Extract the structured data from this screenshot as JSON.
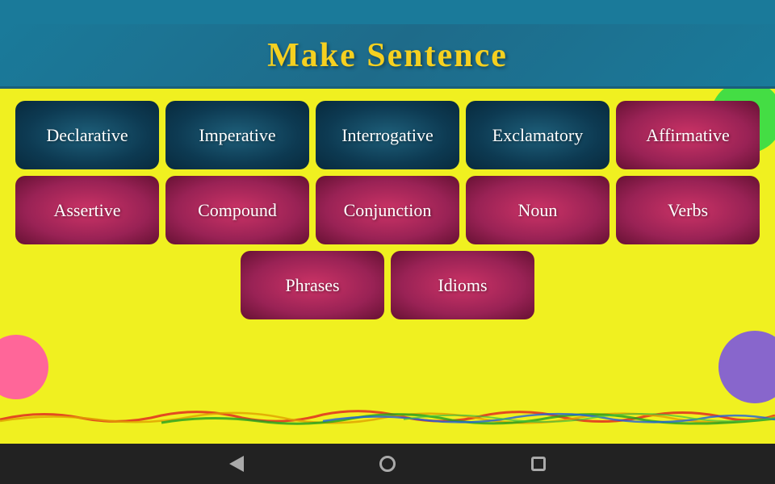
{
  "header": {
    "title": "Make Sentence"
  },
  "rows": [
    {
      "id": "row1",
      "cards": [
        {
          "id": "declarative",
          "label": "Declarative",
          "style": "teal"
        },
        {
          "id": "imperative",
          "label": "Imperative",
          "style": "teal"
        },
        {
          "id": "interrogative",
          "label": "Interrogative",
          "style": "teal"
        },
        {
          "id": "exclamatory",
          "label": "Exclamatory",
          "style": "teal"
        },
        {
          "id": "affirmative",
          "label": "Affirmative",
          "style": "pink"
        }
      ]
    },
    {
      "id": "row2",
      "cards": [
        {
          "id": "assertive",
          "label": "Assertive",
          "style": "pink"
        },
        {
          "id": "compound",
          "label": "Compound",
          "style": "pink"
        },
        {
          "id": "conjunction",
          "label": "Conjunction",
          "style": "pink"
        },
        {
          "id": "noun",
          "label": "Noun",
          "style": "pink"
        },
        {
          "id": "verbs",
          "label": "Verbs",
          "style": "pink"
        }
      ]
    },
    {
      "id": "row3",
      "cards": [
        {
          "id": "phrases",
          "label": "Phrases",
          "style": "pink"
        },
        {
          "id": "idioms",
          "label": "Idioms",
          "style": "pink"
        }
      ]
    }
  ],
  "nav": {
    "back_label": "back",
    "home_label": "home",
    "recents_label": "recents"
  }
}
